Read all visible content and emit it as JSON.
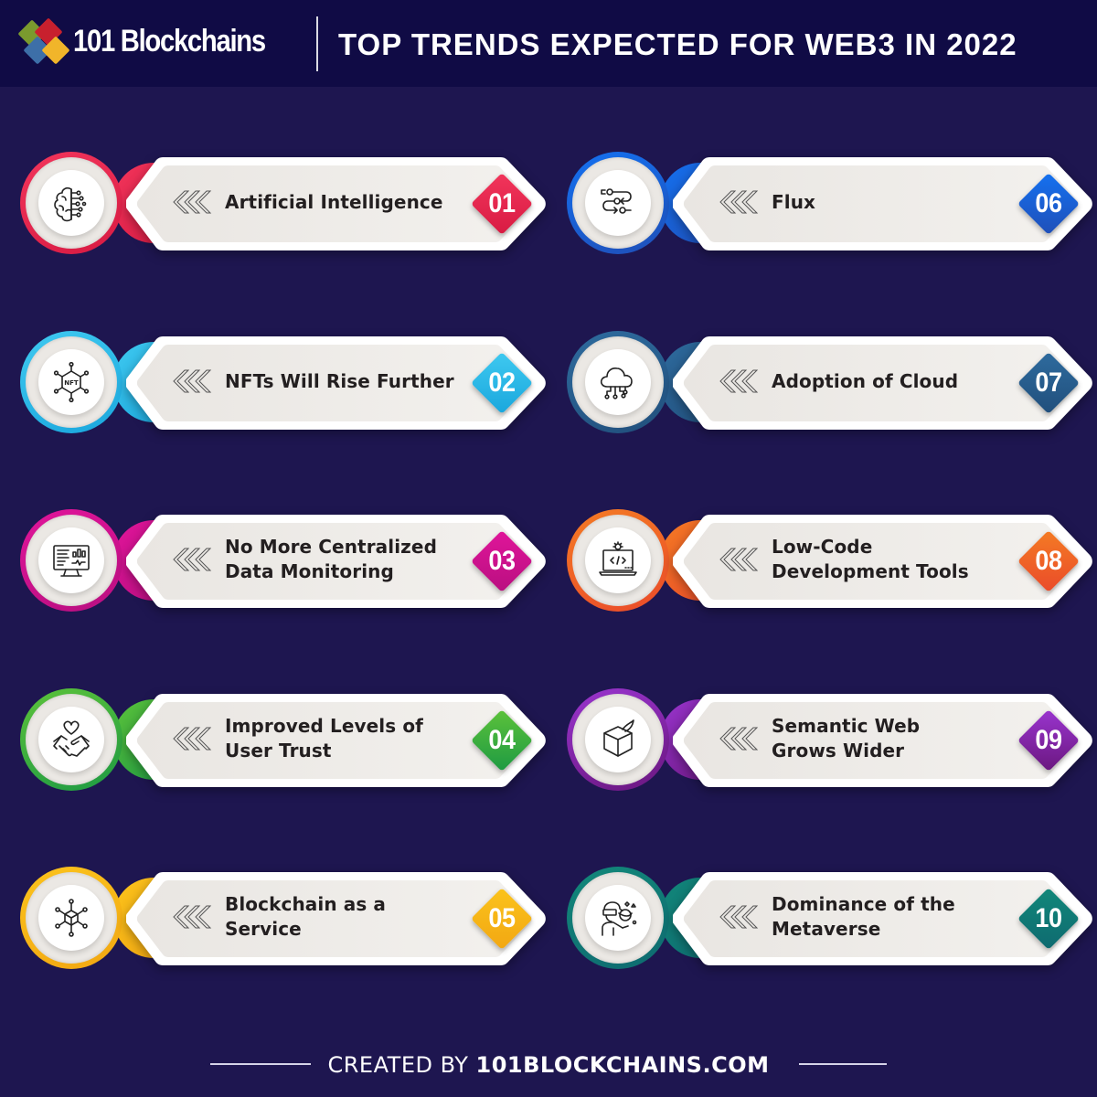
{
  "header": {
    "brand": "101 Blockchains",
    "title": "TOP TRENDS EXPECTED FOR WEB3 IN 2022",
    "logo_colors": [
      "#7a9a2e",
      "#c8202e",
      "#6f9fd6",
      "#f1b52a"
    ]
  },
  "trends": [
    {
      "number": "01",
      "lines": [
        "Artificial Intelligence"
      ],
      "icon": "brain-circuit-icon",
      "color": "#f2355b",
      "color_dark": "#d81b43"
    },
    {
      "number": "02",
      "lines": [
        "NFTs Will Rise Further"
      ],
      "icon": "nft-network-icon",
      "color": "#3fc9f0",
      "color_dark": "#1aa7dd"
    },
    {
      "number": "03",
      "lines": [
        "No More Centralized",
        "Data Monitoring"
      ],
      "icon": "monitor-dashboard-icon",
      "color": "#e0159a",
      "color_dark": "#b90f80"
    },
    {
      "number": "04",
      "lines": [
        "Improved Levels of",
        "User Trust"
      ],
      "icon": "handshake-heart-icon",
      "color": "#5cc23a",
      "color_dark": "#1e9a43"
    },
    {
      "number": "05",
      "lines": [
        "Blockchain as a",
        "Service"
      ],
      "icon": "blockchain-network-icon",
      "color": "#fbc31c",
      "color_dark": "#f2a712"
    },
    {
      "number": "06",
      "lines": [
        "Flux"
      ],
      "icon": "flow-arrows-icon",
      "color": "#1471f0",
      "color_dark": "#1f4fb8"
    },
    {
      "number": "07",
      "lines": [
        "Adoption of Cloud"
      ],
      "icon": "cloud-network-icon",
      "color": "#2e6b9e",
      "color_dark": "#214f7c"
    },
    {
      "number": "08",
      "lines": [
        "Low-Code",
        "Development Tools"
      ],
      "icon": "laptop-code-icon",
      "color": "#f47b24",
      "color_dark": "#ea4b2a"
    },
    {
      "number": "09",
      "lines": [
        "Semantic Web",
        "Grows Wider"
      ],
      "icon": "open-box-icon",
      "color": "#9a35cf",
      "color_dark": "#6a177f"
    },
    {
      "number": "10",
      "lines": [
        "Dominance of the",
        "Metaverse"
      ],
      "icon": "vr-user-icon",
      "color": "#12887a",
      "color_dark": "#0e6a70"
    }
  ],
  "footer": {
    "prefix": "CREATED BY ",
    "site": "101BLOCKCHAINS.COM"
  }
}
